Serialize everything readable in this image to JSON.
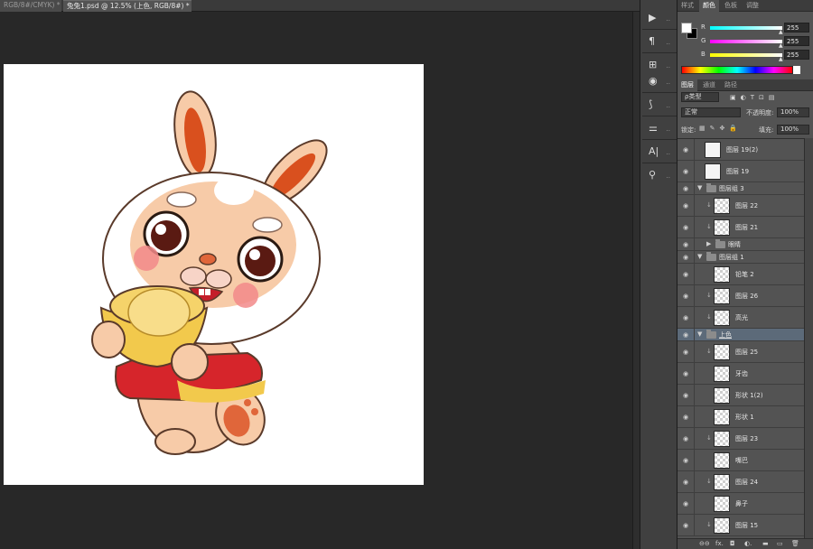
{
  "tabs": [
    {
      "label": "RGB/8#/CMYK) *"
    },
    {
      "label": "兔兔1.psd @ 12.5% (上色, RGB/8#) *"
    }
  ],
  "tab_close": "×",
  "tools": [
    {
      "name": "play-icon",
      "glyph": "▶"
    },
    {
      "name": "paragraph-icon",
      "glyph": "¶"
    },
    {
      "name": "adjust-icon",
      "glyph": "⊞"
    },
    {
      "name": "color-wheel-icon",
      "glyph": "◉"
    },
    {
      "name": "brush-icon",
      "glyph": "⟆"
    },
    {
      "name": "sliders-icon",
      "glyph": "⚌"
    },
    {
      "name": "type-icon",
      "glyph": "A|"
    },
    {
      "name": "clone-icon",
      "glyph": "⚲"
    }
  ],
  "color_panel": {
    "tabs": [
      "样式",
      "颜色",
      "色板",
      "调整"
    ],
    "active_tab": 1,
    "channels": [
      {
        "label": "R",
        "value": "255"
      },
      {
        "label": "G",
        "value": "255"
      },
      {
        "label": "B",
        "value": "255"
      }
    ]
  },
  "layers_panel": {
    "tabs": [
      "图层",
      "通道",
      "路径"
    ],
    "active_tab": 0,
    "filter_kind": "ρ类型",
    "filter_icons": "▣◐T⊡▤",
    "blend_mode": "正常",
    "opacity_label": "不透明度:",
    "opacity_value": "100%",
    "lock_label": "锁定:",
    "lock_icons": "▦✎✥🔒",
    "fill_label": "填充:",
    "fill_value": "100%",
    "layers": [
      {
        "name": "图层 19(2)",
        "type": "layer",
        "indent": 0,
        "clip": false,
        "thumb": "solid"
      },
      {
        "name": "图层 19",
        "type": "layer",
        "indent": 0,
        "clip": false,
        "thumb": "solid"
      },
      {
        "name": "图层组 3",
        "type": "group",
        "indent": 0,
        "open": true
      },
      {
        "name": "图层 22",
        "type": "layer",
        "indent": 1,
        "clip": true,
        "thumb": "checker"
      },
      {
        "name": "图层 21",
        "type": "layer",
        "indent": 1,
        "clip": true,
        "thumb": "checker"
      },
      {
        "name": "眼睛",
        "type": "group",
        "indent": 1,
        "open": false
      },
      {
        "name": "图层组 1",
        "type": "group",
        "indent": 0,
        "open": true
      },
      {
        "name": "铅笔 2",
        "type": "layer",
        "indent": 1,
        "clip": false,
        "thumb": "checker"
      },
      {
        "name": "图层 26",
        "type": "layer",
        "indent": 1,
        "clip": true,
        "thumb": "checker"
      },
      {
        "name": "高光",
        "type": "layer",
        "indent": 1,
        "clip": true,
        "thumb": "checker"
      },
      {
        "name": "上色",
        "type": "group",
        "indent": 0,
        "open": true,
        "selected": true
      },
      {
        "name": "图层 25",
        "type": "layer",
        "indent": 1,
        "clip": true,
        "thumb": "checker"
      },
      {
        "name": "牙齿",
        "type": "layer",
        "indent": 1,
        "clip": false,
        "thumb": "checker"
      },
      {
        "name": "形状 1(2)",
        "type": "layer",
        "indent": 1,
        "clip": false,
        "thumb": "checker"
      },
      {
        "name": "形状 1",
        "type": "layer",
        "indent": 1,
        "clip": false,
        "thumb": "checker"
      },
      {
        "name": "图层 23",
        "type": "layer",
        "indent": 1,
        "clip": true,
        "thumb": "checker"
      },
      {
        "name": "嘴巴",
        "type": "layer",
        "indent": 1,
        "clip": false,
        "thumb": "checker"
      },
      {
        "name": "图层 24",
        "type": "layer",
        "indent": 1,
        "clip": true,
        "thumb": "checker"
      },
      {
        "name": "鼻子",
        "type": "layer",
        "indent": 1,
        "clip": false,
        "thumb": "checker"
      },
      {
        "name": "图层 15",
        "type": "layer",
        "indent": 1,
        "clip": true,
        "thumb": "checker"
      }
    ],
    "footer": [
      "⊖⊖",
      "fx.",
      "◘",
      "◐.",
      "▬",
      "▭",
      "🗑"
    ]
  },
  "colors": {
    "panel_bg": "#535353",
    "selection": "#5c6a79",
    "canvas_bg": "#282828"
  }
}
